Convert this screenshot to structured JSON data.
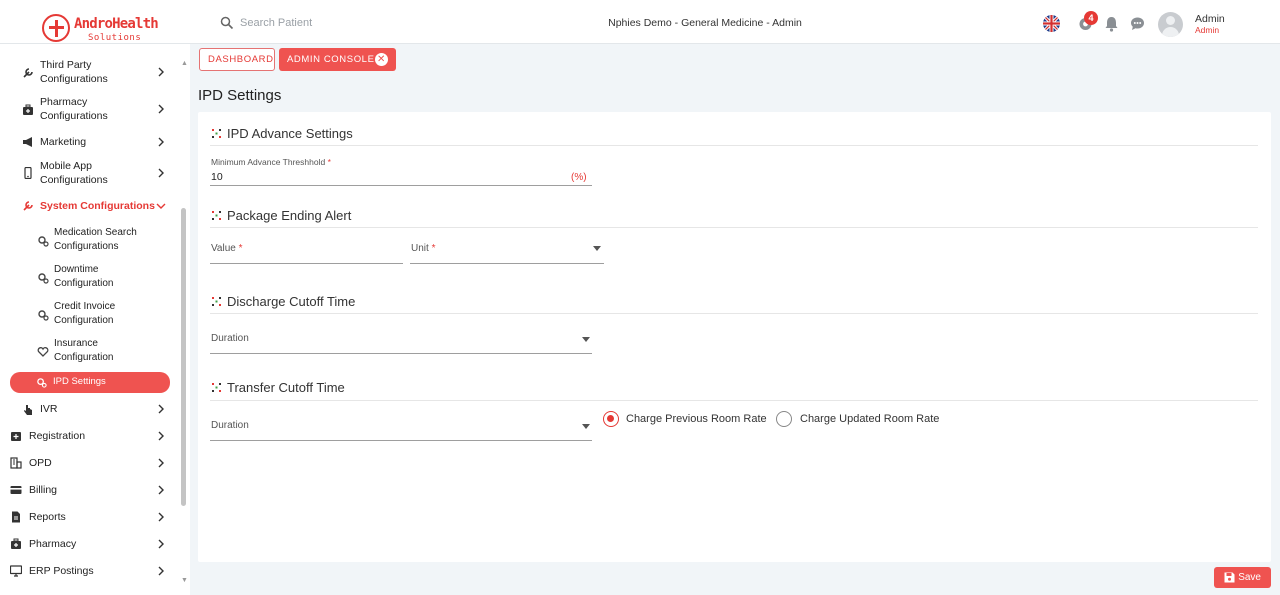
{
  "brand": {
    "name": "AndroHealth",
    "sub": "Solutions"
  },
  "header": {
    "search_placeholder": "Search Patient",
    "context": "Nphies Demo - General Medicine - Admin",
    "notification_count": "4",
    "user_name": "Admin",
    "user_role": "Admin"
  },
  "sidebar": {
    "items": [
      {
        "label_1": "Third Party",
        "label_2": "Configurations",
        "icon": "wrench-icon"
      },
      {
        "label_1": "Pharmacy",
        "label_2": "Configurations",
        "icon": "medkit-icon"
      },
      {
        "label_1": "Marketing",
        "icon": "megaphone-icon"
      },
      {
        "label_1": "Mobile App",
        "label_2": "Configurations",
        "icon": "mobile-icon"
      },
      {
        "label_1": "System Configurations",
        "icon": "wrench-icon",
        "active": true
      },
      {
        "label_1": "IVR",
        "icon": "hand-icon"
      },
      {
        "label_1": "Registration",
        "icon": "register-icon"
      },
      {
        "label_1": "OPD",
        "icon": "building-icon"
      },
      {
        "label_1": "Billing",
        "icon": "card-icon"
      },
      {
        "label_1": "Reports",
        "icon": "file-icon"
      },
      {
        "label_1": "Pharmacy",
        "icon": "medkit-icon"
      },
      {
        "label_1": "ERP Postings",
        "icon": "monitor-icon"
      }
    ],
    "sub_items": [
      {
        "label_1": "Medication Search",
        "label_2": "Configurations"
      },
      {
        "label_1": "Downtime",
        "label_2": "Configuration"
      },
      {
        "label_1": "Credit Invoice",
        "label_2": "Configuration"
      },
      {
        "label_1": "Insurance",
        "label_2": "Configuration"
      }
    ],
    "selected_sub": "IPD Settings"
  },
  "breadcrumb": {
    "dashboard": "DASHBOARD",
    "admin_console": "ADMIN CONSOLE"
  },
  "page": {
    "title": "IPD Settings"
  },
  "sections": {
    "advance": {
      "title": "IPD Advance Settings",
      "min_label": "Minimum Advance Threshhold",
      "min_value": "10",
      "min_unit": "(%)"
    },
    "package": {
      "title": "Package Ending Alert",
      "value_label": "Value",
      "unit_label": "Unit"
    },
    "discharge": {
      "title": "Discharge Cutoff Time",
      "duration_label": "Duration"
    },
    "transfer": {
      "title": "Transfer Cutoff Time",
      "duration_label": "Duration",
      "radio_prev": "Charge Previous Room Rate",
      "radio_updated": "Charge Updated Room Rate",
      "selected": "prev"
    }
  },
  "actions": {
    "save": "Save"
  },
  "colors": {
    "accent": "#ef5350",
    "accent_dark": "#e53935"
  }
}
